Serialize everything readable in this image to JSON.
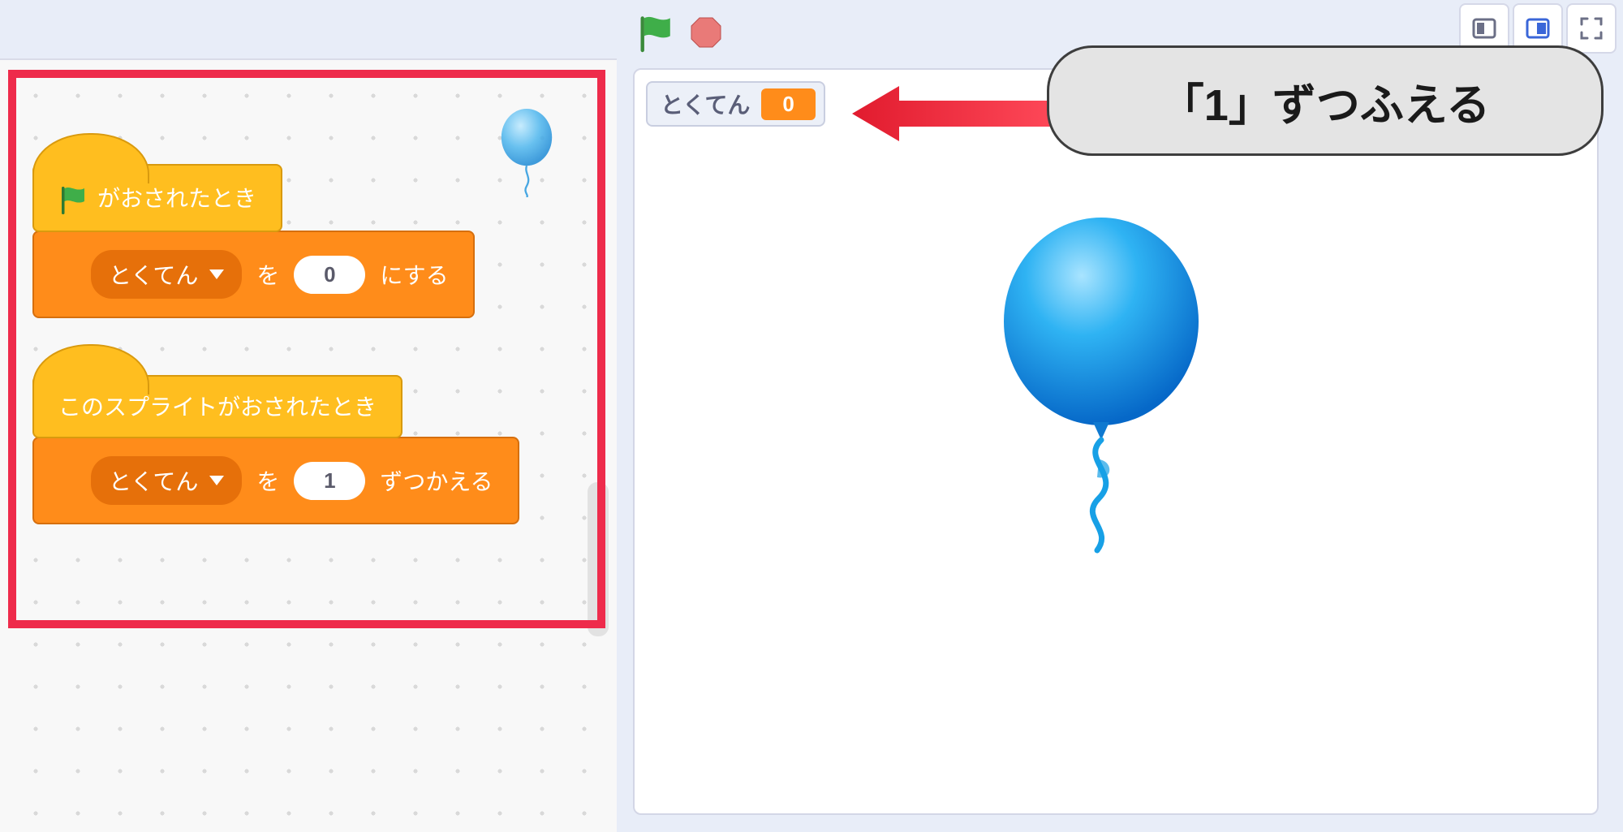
{
  "header": {
    "run_tooltip": "Go",
    "stop_tooltip": "Stop"
  },
  "script": {
    "hat1_label": "がおされたとき",
    "cmd1_var": "とくてん",
    "cmd1_mid": "を",
    "cmd1_value": "0",
    "cmd1_tail": "にする",
    "hat2_label": "このスプライトがおされたとき",
    "cmd2_var": "とくてん",
    "cmd2_mid": "を",
    "cmd2_value": "1",
    "cmd2_tail": "ずつかえる"
  },
  "stage": {
    "monitor_label": "とくてん",
    "monitor_value": "0"
  },
  "callout": {
    "text": "「1」ずつふえる"
  }
}
